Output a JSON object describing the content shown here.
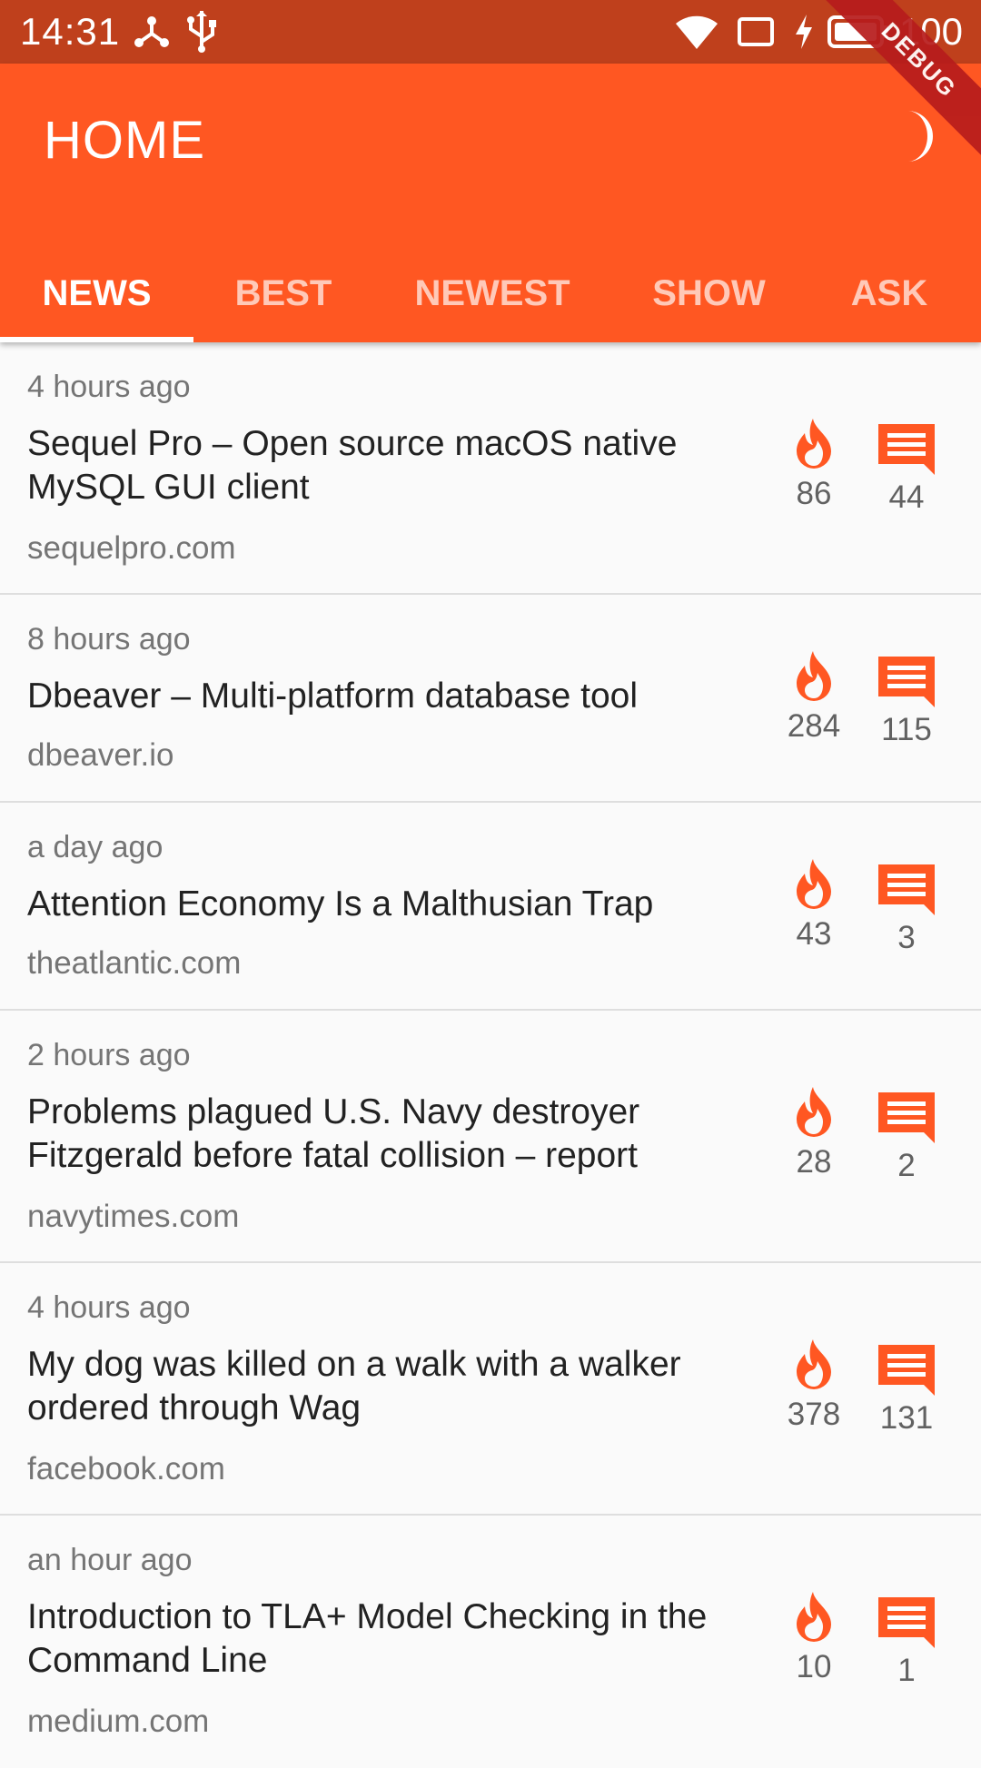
{
  "status_bar": {
    "time": "14:31",
    "battery": "100"
  },
  "app_bar": {
    "title": "HOME",
    "debug_banner": "DEBUG"
  },
  "tabs": [
    {
      "label": "NEWS",
      "active": true
    },
    {
      "label": "BEST",
      "active": false
    },
    {
      "label": "NEWEST",
      "active": false
    },
    {
      "label": "SHOW",
      "active": false
    },
    {
      "label": "ASK",
      "active": false
    }
  ],
  "stories": [
    {
      "time": "4 hours ago",
      "title_lines": [
        "Sequel Pro – Open source macOS native",
        "MySQL GUI client"
      ],
      "domain": "sequelpro.com",
      "score": "86",
      "comments": "44"
    },
    {
      "time": "8 hours ago",
      "title_lines": [
        "Dbeaver – Multi-platform database tool"
      ],
      "domain": "dbeaver.io",
      "score": "284",
      "comments": "115"
    },
    {
      "time": "a day ago",
      "title_lines": [
        "Attention Economy Is a Malthusian Trap"
      ],
      "domain": "theatlantic.com",
      "score": "43",
      "comments": "3"
    },
    {
      "time": "2 hours ago",
      "title_lines": [
        "Problems plagued U.S. Navy destroyer",
        "Fitzgerald before fatal collision – report"
      ],
      "domain": "navytimes.com",
      "score": "28",
      "comments": "2"
    },
    {
      "time": "4 hours ago",
      "title_lines": [
        "My dog was killed on a walk with a walker",
        "ordered through Wag"
      ],
      "domain": "facebook.com",
      "score": "378",
      "comments": "131"
    },
    {
      "time": "an hour ago",
      "title_lines": [
        "Introduction to TLA+ Model Checking in the",
        "Command Line"
      ],
      "domain": "medium.com",
      "score": "10",
      "comments": "1"
    }
  ],
  "icons": {
    "score": "flame-icon",
    "comments": "comment-icon",
    "theme": "moon-icon"
  },
  "colors": {
    "accent": "#ff5722",
    "status_bar": "#bf401c",
    "background": "#fafafa"
  }
}
